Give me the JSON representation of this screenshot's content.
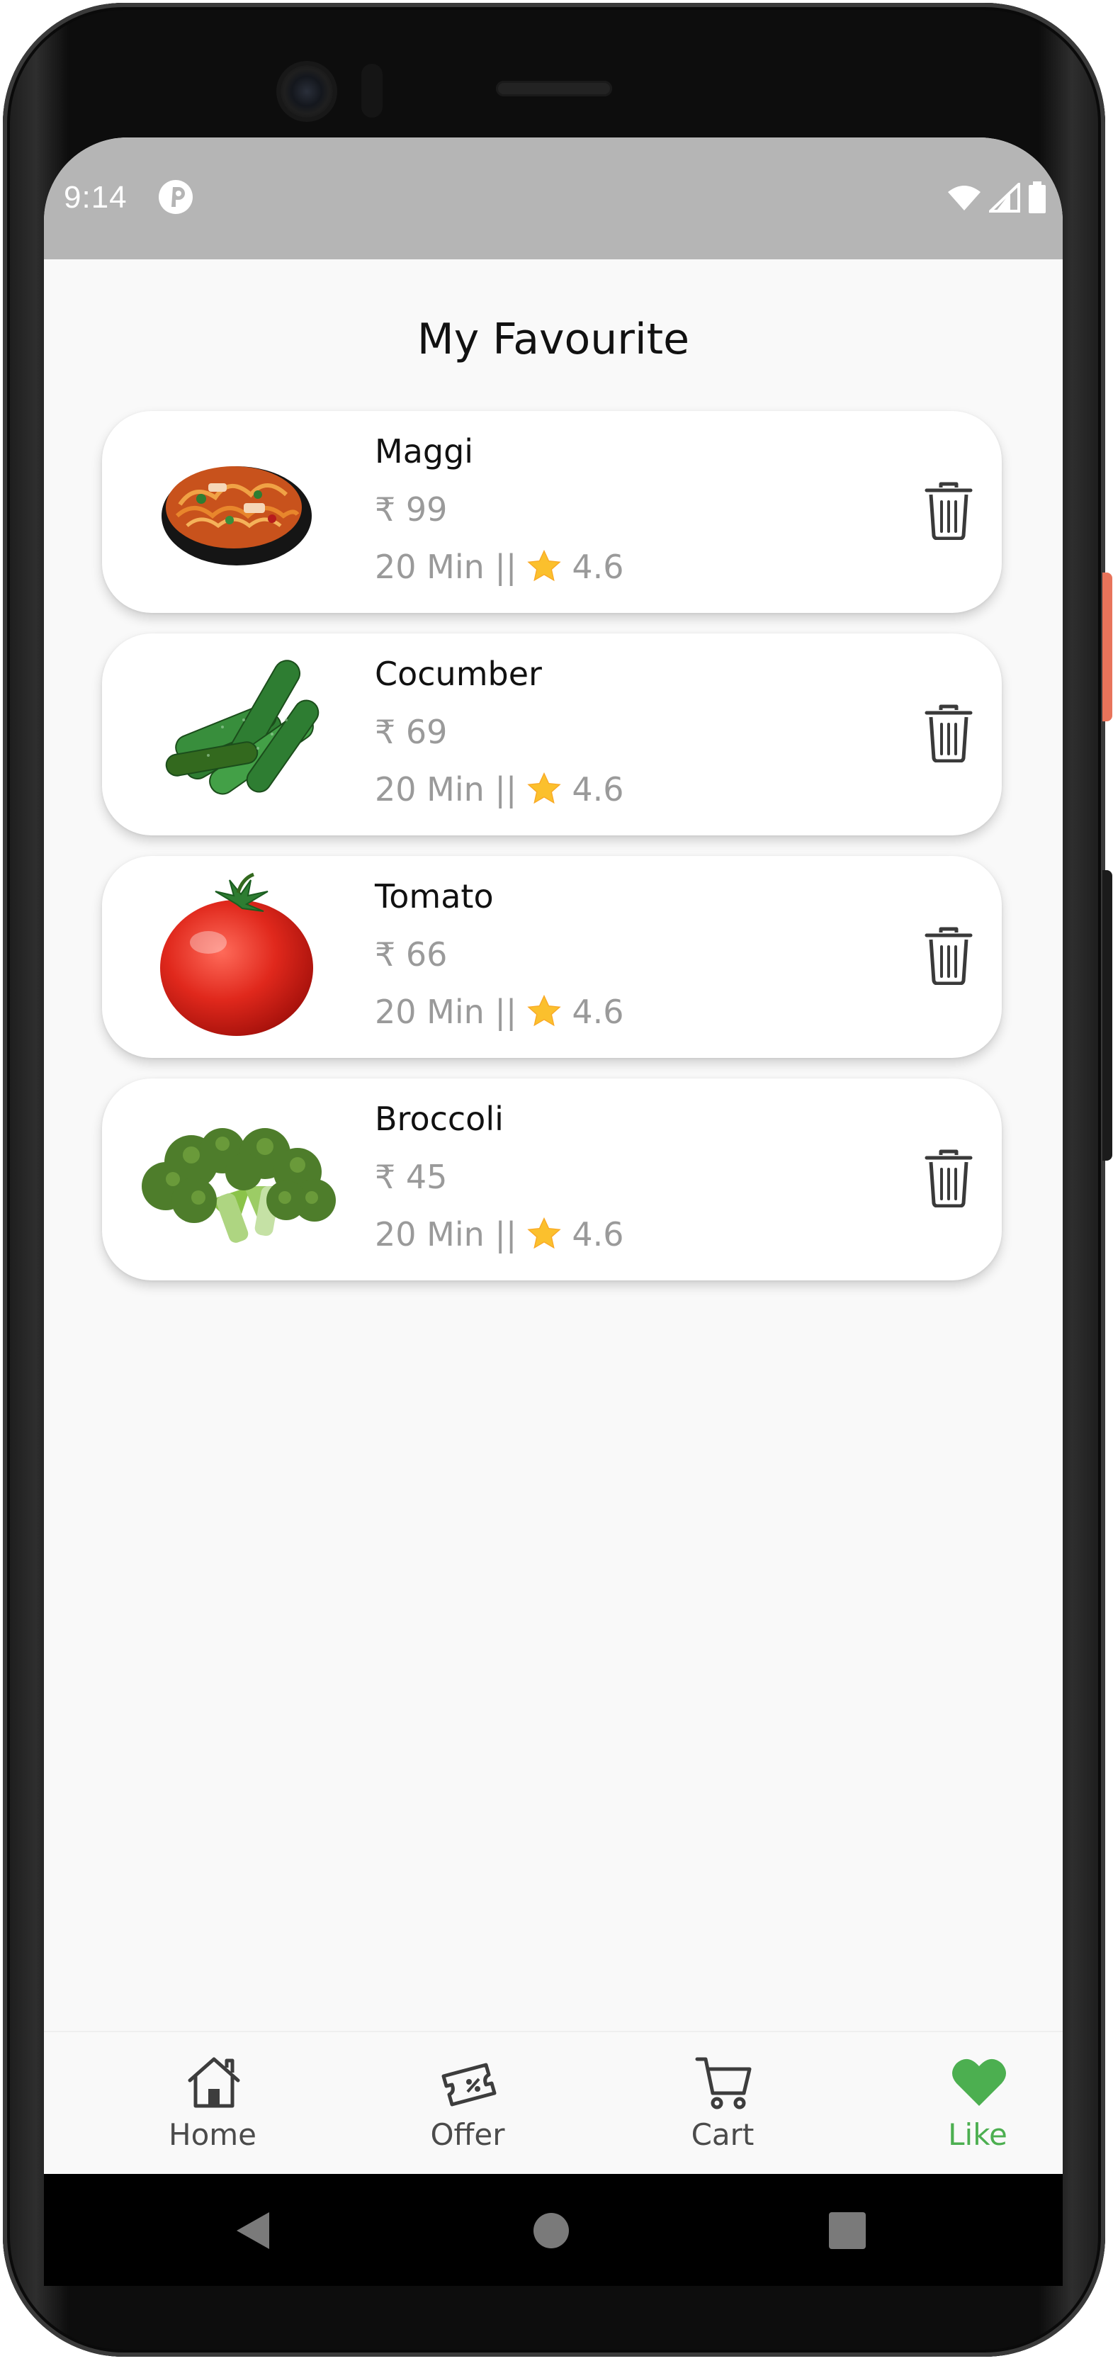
{
  "status_bar": {
    "time": "9:14"
  },
  "page": {
    "title": "My Favourite"
  },
  "items": [
    {
      "name": "Maggi",
      "price": "₹ 99",
      "time": "20 Min ||",
      "rating": "4.6",
      "image_icon": "noodles-image"
    },
    {
      "name": "Cocumber",
      "price": "₹ 69",
      "time": "20 Min ||",
      "rating": "4.6",
      "image_icon": "cucumber-image"
    },
    {
      "name": "Tomato",
      "price": "₹ 66",
      "time": "20 Min ||",
      "rating": "4.6",
      "image_icon": "tomato-image"
    },
    {
      "name": "Broccoli",
      "price": "₹ 45",
      "time": "20 Min ||",
      "rating": "4.6",
      "image_icon": "broccoli-image"
    }
  ],
  "bottom_nav": {
    "items": [
      {
        "label": "Home",
        "icon": "home-icon",
        "active": false
      },
      {
        "label": "Offer",
        "icon": "ticket-icon",
        "active": false
      },
      {
        "label": "Cart",
        "icon": "cart-icon",
        "active": false
      },
      {
        "label": "Like",
        "icon": "heart-icon",
        "active": true
      }
    ]
  },
  "colors": {
    "accent": "#4caf50",
    "status_bar": "#b5b5b5",
    "background": "#f9f9f9",
    "star": "#fbc02d"
  }
}
